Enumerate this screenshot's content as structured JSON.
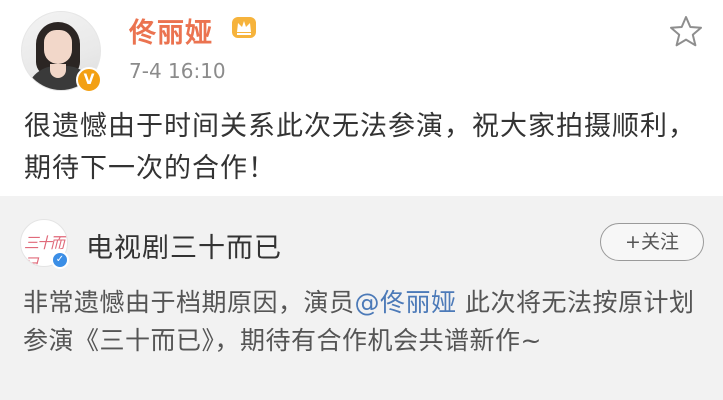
{
  "post": {
    "username": "佟丽娅",
    "timestamp": "7-4 16:10",
    "verified_badge": "V",
    "icons": {
      "crown": "crown-icon",
      "favorite": "star-icon"
    },
    "text": "很遗憾由于时间关系此次无法参演，祝大家拍摄顺利，期待下一次的合作！"
  },
  "repost": {
    "account_name": "电视剧三十而已",
    "avatar_logo_text": "三十而已",
    "follow_label": "+关注",
    "text_before": "非常遗憾由于档期原因，演员",
    "mention": "@佟丽娅",
    "text_after": " 此次将无法按原计划参演《三十而已》，期待有合作机会共谱新作~"
  },
  "colors": {
    "username": "#eb7350",
    "mention": "#4c7ab8",
    "verified_gold": "#f3a013",
    "verified_blue": "#3b8ee6",
    "repost_bg": "#f2f2f2"
  }
}
